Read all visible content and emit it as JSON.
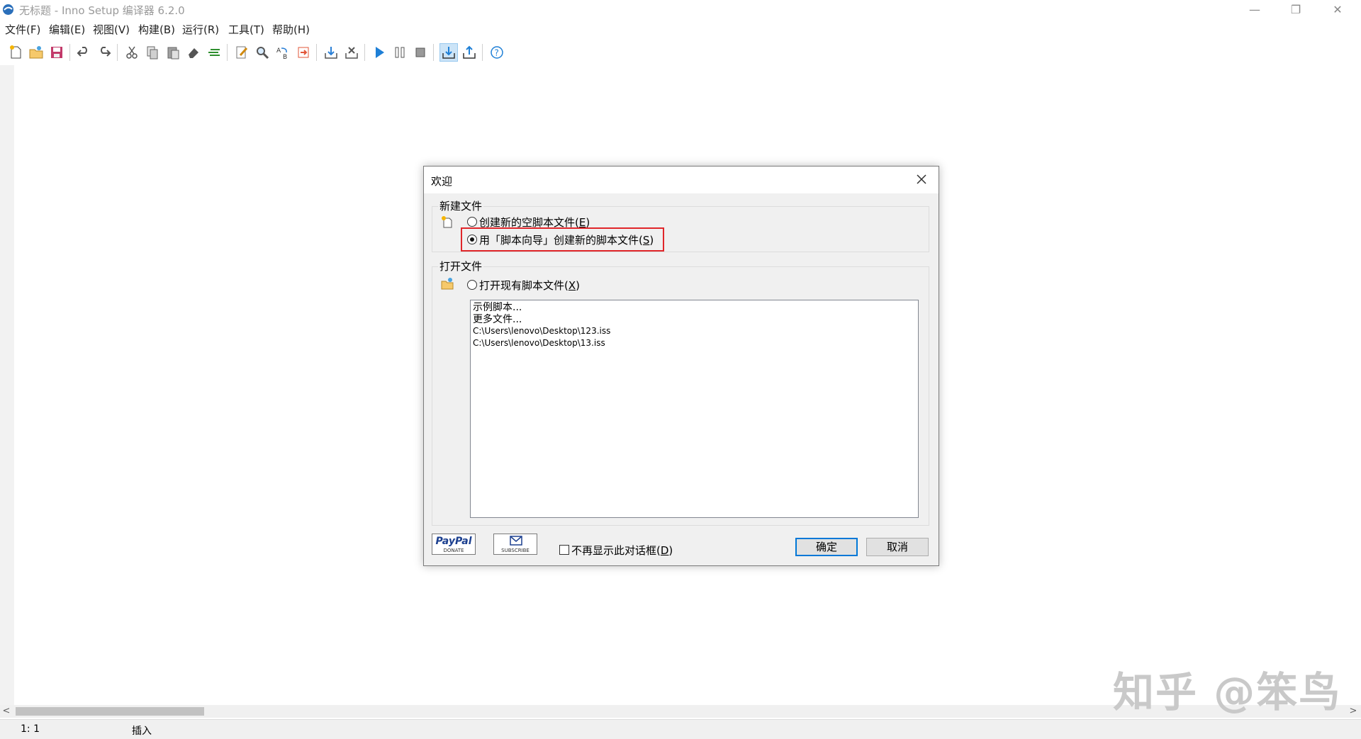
{
  "window": {
    "title": "无标题 - Inno Setup 编译器 6.2.0",
    "controls": {
      "minimize": "—",
      "restore": "❐",
      "close": "✕"
    }
  },
  "menu": [
    "文件(F)",
    "编辑(E)",
    "视图(V)",
    "构建(B)",
    "运行(R)",
    "工具(T)",
    "帮助(H)"
  ],
  "toolbar_icons": [
    "new-file-icon",
    "open-file-icon",
    "save-icon",
    "undo-icon",
    "redo-icon",
    "cut-icon",
    "copy-icon",
    "paste-icon",
    "erase-icon",
    "indent-icon",
    "edit-icon",
    "find-icon",
    "replace-icon",
    "goto-icon",
    "compile-icon",
    "stop-compile-icon",
    "run-icon",
    "pause-icon",
    "stop-icon",
    "target-icon",
    "export-icon",
    "help-icon"
  ],
  "status": {
    "position": "1:  1",
    "mode": "插入"
  },
  "scrollbar": {
    "left_arrow": "<",
    "right_arrow": ">"
  },
  "watermark": "知乎 @笨鸟",
  "dialog": {
    "title": "欢迎",
    "new_group": {
      "label": "新建文件",
      "options": [
        {
          "text": "创建新的空脚本文件(",
          "key": "E",
          "end": ")",
          "checked": false
        },
        {
          "text": "用「脚本向导」创建新的脚本文件(",
          "key": "S",
          "end": ")",
          "checked": true
        }
      ]
    },
    "open_group": {
      "label": "打开文件",
      "option": {
        "text": "打开现有脚本文件(",
        "key": "X",
        "end": ")",
        "checked": false
      },
      "files": [
        "示例脚本...",
        "更多文件...",
        "C:\\Users\\lenovo\\Desktop\\123.iss",
        "C:\\Users\\lenovo\\Desktop\\13.iss"
      ]
    },
    "paypal": {
      "brand": "PayPal",
      "caption": "DONATE"
    },
    "subscribe": {
      "caption": "SUBSCRIBE"
    },
    "dont_show": {
      "text": "不再显示此对话框(",
      "key": "D",
      "end": ")",
      "checked": false
    },
    "ok_label": "确定",
    "cancel_label": "取消"
  },
  "colors": {
    "highlight": "#e0262a",
    "focus": "#0078d7",
    "accent_blue": "#1e7fd6"
  }
}
